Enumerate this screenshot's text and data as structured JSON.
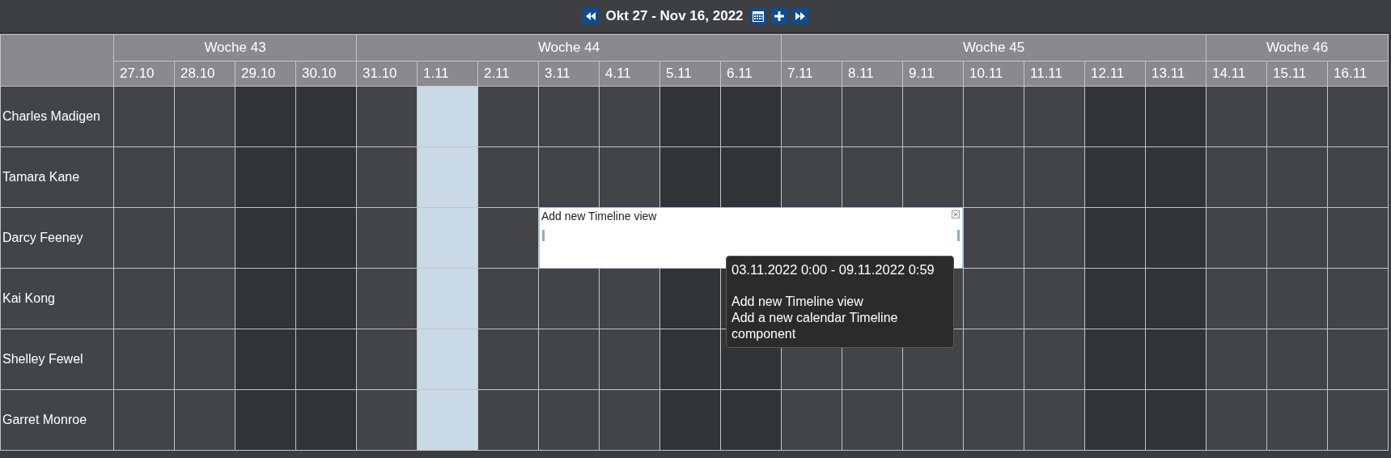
{
  "toolbar": {
    "title": "Okt 27 - Nov 16, 2022"
  },
  "weeks": [
    {
      "label": "Woche 43",
      "days": [
        {
          "label": "27.10",
          "kind": "weekday"
        },
        {
          "label": "28.10",
          "kind": "weekday"
        },
        {
          "label": "29.10",
          "kind": "weekend"
        },
        {
          "label": "30.10",
          "kind": "weekend"
        }
      ]
    },
    {
      "label": "Woche 44",
      "days": [
        {
          "label": "31.10",
          "kind": "weekday"
        },
        {
          "label": "1.11",
          "kind": "today"
        },
        {
          "label": "2.11",
          "kind": "weekday"
        },
        {
          "label": "3.11",
          "kind": "weekday"
        },
        {
          "label": "4.11",
          "kind": "weekday"
        },
        {
          "label": "5.11",
          "kind": "weekend"
        },
        {
          "label": "6.11",
          "kind": "weekend"
        }
      ]
    },
    {
      "label": "Woche 45",
      "days": [
        {
          "label": "7.11",
          "kind": "weekday"
        },
        {
          "label": "8.11",
          "kind": "weekday"
        },
        {
          "label": "9.11",
          "kind": "weekday"
        },
        {
          "label": "10.11",
          "kind": "weekday"
        },
        {
          "label": "11.11",
          "kind": "weekday"
        },
        {
          "label": "12.11",
          "kind": "weekend"
        },
        {
          "label": "13.11",
          "kind": "weekend"
        }
      ]
    },
    {
      "label": "Woche 46",
      "days": [
        {
          "label": "14.11",
          "kind": "weekday"
        },
        {
          "label": "15.11",
          "kind": "weekday"
        },
        {
          "label": "16.11",
          "kind": "weekday"
        }
      ]
    }
  ],
  "resources": [
    {
      "name": "Charles Madigen"
    },
    {
      "name": "Tamara Kane"
    },
    {
      "name": "Darcy Feeney",
      "event": {
        "title": "Add new Timeline view",
        "covers": [
          false,
          false,
          false,
          false,
          false,
          false,
          false,
          true,
          true,
          true,
          true,
          true,
          true,
          true,
          false,
          false,
          false,
          false,
          false,
          false,
          false
        ]
      }
    },
    {
      "name": "Kai Kong"
    },
    {
      "name": "Shelley Fewel"
    },
    {
      "name": "Garret Monroe"
    }
  ],
  "tooltip": {
    "range": "03.11.2022 0:00 - 09.11.2022 0:59",
    "title": "Add new Timeline view",
    "description": "Add a new calendar Timeline component"
  }
}
